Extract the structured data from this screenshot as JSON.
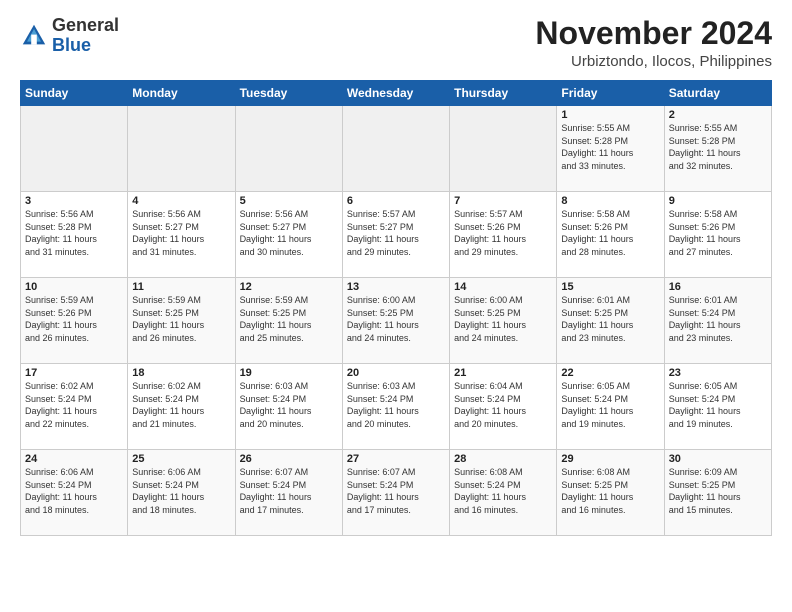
{
  "app": {
    "name_general": "General",
    "name_blue": "Blue"
  },
  "header": {
    "month": "November 2024",
    "location": "Urbiztondo, Ilocos, Philippines"
  },
  "weekdays": [
    "Sunday",
    "Monday",
    "Tuesday",
    "Wednesday",
    "Thursday",
    "Friday",
    "Saturday"
  ],
  "weeks": [
    [
      {
        "num": "",
        "info": ""
      },
      {
        "num": "",
        "info": ""
      },
      {
        "num": "",
        "info": ""
      },
      {
        "num": "",
        "info": ""
      },
      {
        "num": "",
        "info": ""
      },
      {
        "num": "1",
        "info": "Sunrise: 5:55 AM\nSunset: 5:28 PM\nDaylight: 11 hours\nand 33 minutes."
      },
      {
        "num": "2",
        "info": "Sunrise: 5:55 AM\nSunset: 5:28 PM\nDaylight: 11 hours\nand 32 minutes."
      }
    ],
    [
      {
        "num": "3",
        "info": "Sunrise: 5:56 AM\nSunset: 5:28 PM\nDaylight: 11 hours\nand 31 minutes."
      },
      {
        "num": "4",
        "info": "Sunrise: 5:56 AM\nSunset: 5:27 PM\nDaylight: 11 hours\nand 31 minutes."
      },
      {
        "num": "5",
        "info": "Sunrise: 5:56 AM\nSunset: 5:27 PM\nDaylight: 11 hours\nand 30 minutes."
      },
      {
        "num": "6",
        "info": "Sunrise: 5:57 AM\nSunset: 5:27 PM\nDaylight: 11 hours\nand 29 minutes."
      },
      {
        "num": "7",
        "info": "Sunrise: 5:57 AM\nSunset: 5:26 PM\nDaylight: 11 hours\nand 29 minutes."
      },
      {
        "num": "8",
        "info": "Sunrise: 5:58 AM\nSunset: 5:26 PM\nDaylight: 11 hours\nand 28 minutes."
      },
      {
        "num": "9",
        "info": "Sunrise: 5:58 AM\nSunset: 5:26 PM\nDaylight: 11 hours\nand 27 minutes."
      }
    ],
    [
      {
        "num": "10",
        "info": "Sunrise: 5:59 AM\nSunset: 5:26 PM\nDaylight: 11 hours\nand 26 minutes."
      },
      {
        "num": "11",
        "info": "Sunrise: 5:59 AM\nSunset: 5:25 PM\nDaylight: 11 hours\nand 26 minutes."
      },
      {
        "num": "12",
        "info": "Sunrise: 5:59 AM\nSunset: 5:25 PM\nDaylight: 11 hours\nand 25 minutes."
      },
      {
        "num": "13",
        "info": "Sunrise: 6:00 AM\nSunset: 5:25 PM\nDaylight: 11 hours\nand 24 minutes."
      },
      {
        "num": "14",
        "info": "Sunrise: 6:00 AM\nSunset: 5:25 PM\nDaylight: 11 hours\nand 24 minutes."
      },
      {
        "num": "15",
        "info": "Sunrise: 6:01 AM\nSunset: 5:25 PM\nDaylight: 11 hours\nand 23 minutes."
      },
      {
        "num": "16",
        "info": "Sunrise: 6:01 AM\nSunset: 5:24 PM\nDaylight: 11 hours\nand 23 minutes."
      }
    ],
    [
      {
        "num": "17",
        "info": "Sunrise: 6:02 AM\nSunset: 5:24 PM\nDaylight: 11 hours\nand 22 minutes."
      },
      {
        "num": "18",
        "info": "Sunrise: 6:02 AM\nSunset: 5:24 PM\nDaylight: 11 hours\nand 21 minutes."
      },
      {
        "num": "19",
        "info": "Sunrise: 6:03 AM\nSunset: 5:24 PM\nDaylight: 11 hours\nand 20 minutes."
      },
      {
        "num": "20",
        "info": "Sunrise: 6:03 AM\nSunset: 5:24 PM\nDaylight: 11 hours\nand 20 minutes."
      },
      {
        "num": "21",
        "info": "Sunrise: 6:04 AM\nSunset: 5:24 PM\nDaylight: 11 hours\nand 20 minutes."
      },
      {
        "num": "22",
        "info": "Sunrise: 6:05 AM\nSunset: 5:24 PM\nDaylight: 11 hours\nand 19 minutes."
      },
      {
        "num": "23",
        "info": "Sunrise: 6:05 AM\nSunset: 5:24 PM\nDaylight: 11 hours\nand 19 minutes."
      }
    ],
    [
      {
        "num": "24",
        "info": "Sunrise: 6:06 AM\nSunset: 5:24 PM\nDaylight: 11 hours\nand 18 minutes."
      },
      {
        "num": "25",
        "info": "Sunrise: 6:06 AM\nSunset: 5:24 PM\nDaylight: 11 hours\nand 18 minutes."
      },
      {
        "num": "26",
        "info": "Sunrise: 6:07 AM\nSunset: 5:24 PM\nDaylight: 11 hours\nand 17 minutes."
      },
      {
        "num": "27",
        "info": "Sunrise: 6:07 AM\nSunset: 5:24 PM\nDaylight: 11 hours\nand 17 minutes."
      },
      {
        "num": "28",
        "info": "Sunrise: 6:08 AM\nSunset: 5:24 PM\nDaylight: 11 hours\nand 16 minutes."
      },
      {
        "num": "29",
        "info": "Sunrise: 6:08 AM\nSunset: 5:25 PM\nDaylight: 11 hours\nand 16 minutes."
      },
      {
        "num": "30",
        "info": "Sunrise: 6:09 AM\nSunset: 5:25 PM\nDaylight: 11 hours\nand 15 minutes."
      }
    ]
  ]
}
